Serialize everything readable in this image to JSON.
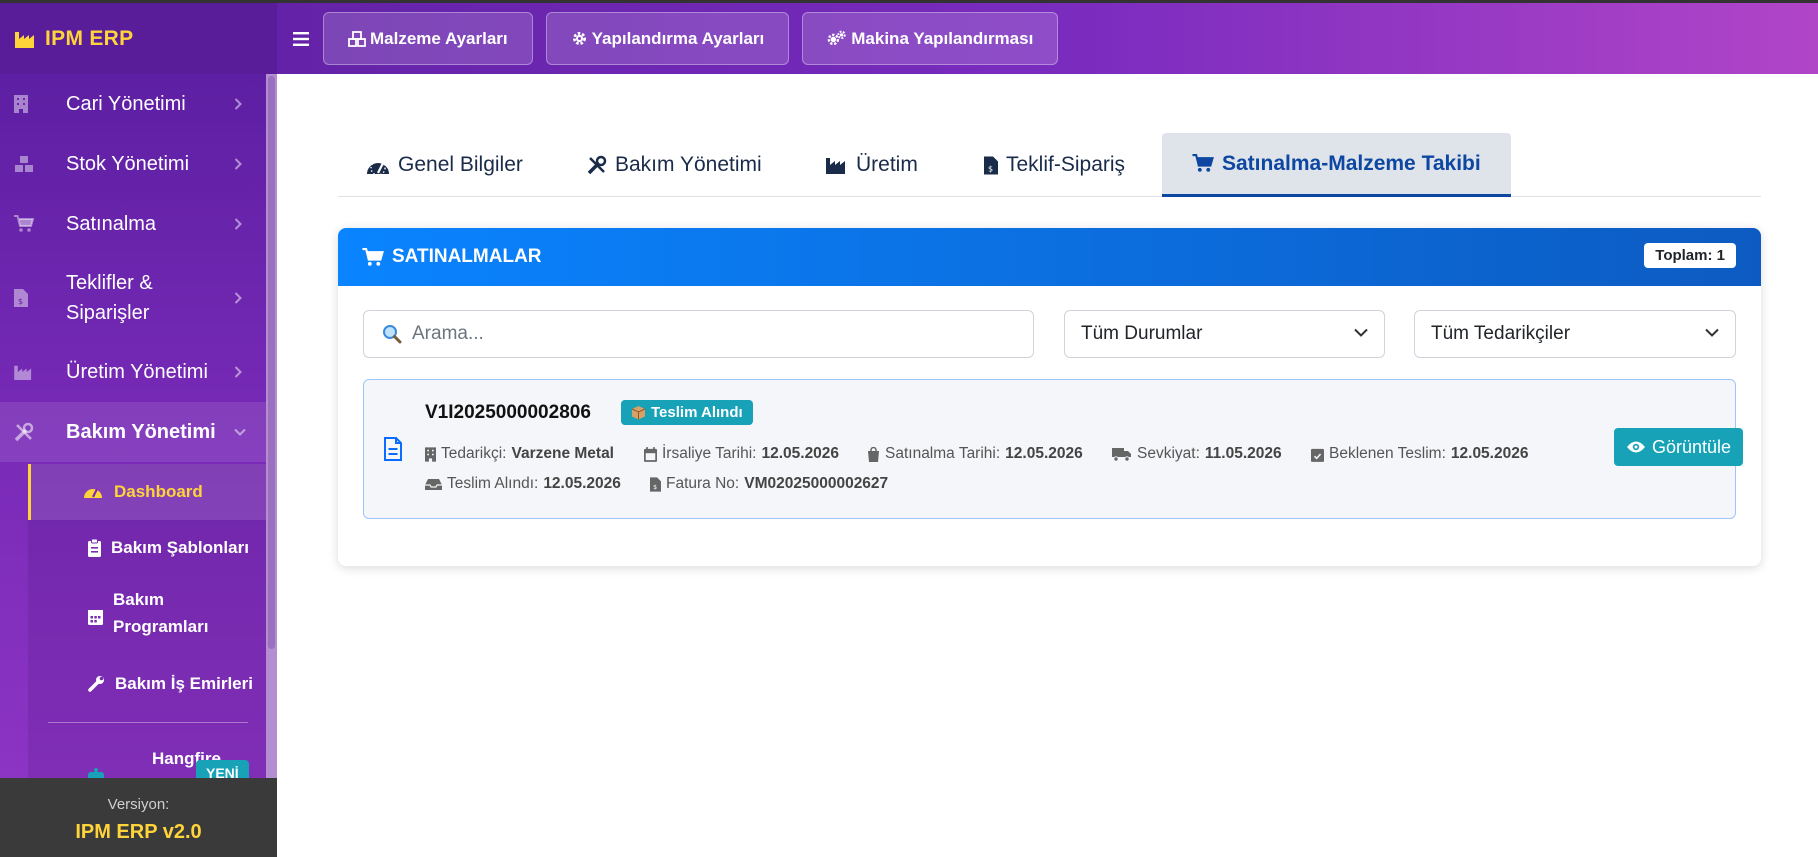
{
  "app": {
    "brand": "IPM ERP"
  },
  "topnav": [
    {
      "label": "Malzeme Ayarları"
    },
    {
      "label": "Yapılandırma Ayarları"
    },
    {
      "label": "Makina Yapılandırması"
    }
  ],
  "sidebar": {
    "items": [
      {
        "label": "Cari Yönetimi",
        "icon": "building-icon"
      },
      {
        "label": "Stok Yönetimi",
        "icon": "boxes-icon"
      },
      {
        "label": "Satınalma",
        "icon": "cart-icon"
      },
      {
        "label": "Teklifler &",
        "label2": "Siparişler",
        "icon": "invoice-icon"
      },
      {
        "label": "Üretim Yönetimi",
        "icon": "industry-icon"
      },
      {
        "label": "Bakım Yönetimi",
        "icon": "tools-icon"
      }
    ],
    "subitems": [
      {
        "label": "Dashboard"
      },
      {
        "label": "Bakım Şablonları"
      },
      {
        "label": "Bakım",
        "label2": "Programları"
      },
      {
        "label": "Bakım İş Emirleri"
      },
      {
        "label": "Hangfire"
      }
    ],
    "badge": "YENİ",
    "version_label": "Versiyon:",
    "version": "IPM ERP v2.0"
  },
  "tabs": [
    {
      "label": "Genel Bilgiler"
    },
    {
      "label": "Bakım Yönetimi"
    },
    {
      "label": "Üretim"
    },
    {
      "label": "Teklif-Sipariş"
    },
    {
      "label": "Satınalma-Malzeme Takibi"
    }
  ],
  "card": {
    "title": "SATINALMALAR",
    "total": "Toplam: 1",
    "search_placeholder": "Arama...",
    "status_filter": "Tüm Durumlar",
    "supplier_filter": "Tüm Tedarikçiler"
  },
  "purchase": {
    "code": "V1I2025000002806",
    "status": "Teslim Alındı",
    "supplier_label": "Tedarikçi:",
    "supplier": "Varzene Metal",
    "irsaliye_label": "İrsaliye Tarihi:",
    "irsaliye": "12.05.2026",
    "satinalma_label": "Satınalma Tarihi:",
    "satinalma": "12.05.2026",
    "sevkiyat_label": "Sevkiyat:",
    "sevkiyat": "11.05.2026",
    "beklenen_label": "Beklenen Teslim:",
    "beklenen": "12.05.2026",
    "teslim_label": "Teslim Alındı:",
    "teslim": "12.05.2026",
    "fatura_label": "Fatura No:",
    "fatura": "VM02025000002627",
    "view_label": "Görüntüle"
  },
  "colors": {
    "brand_purple": "#6a22ad",
    "accent_yellow": "#ffd43b",
    "header_blue": "#0a84ff",
    "teal": "#17a2b8"
  }
}
